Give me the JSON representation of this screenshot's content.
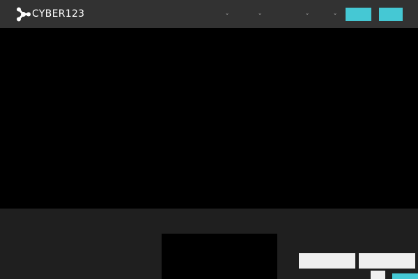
{
  "header": {
    "logo_text": "CYBER123",
    "nav_dropdowns": [
      {
        "icon": "chevron-down-icon",
        "glyph": "⌄"
      },
      {
        "icon": "chevron-down-icon",
        "glyph": "⌄"
      },
      {
        "icon": "chevron-down-icon",
        "glyph": "⌄"
      },
      {
        "icon": "chevron-down-icon",
        "glyph": "⌄"
      }
    ],
    "buttons": [
      "",
      ""
    ]
  },
  "lower": {
    "light_buttons": [
      "",
      ""
    ]
  },
  "colors": {
    "accent": "#45c8d4",
    "header_bg": "#323232",
    "page_bg": "#1f1f1f",
    "hero_bg": "#000000",
    "light_button_bg": "#efefef"
  }
}
